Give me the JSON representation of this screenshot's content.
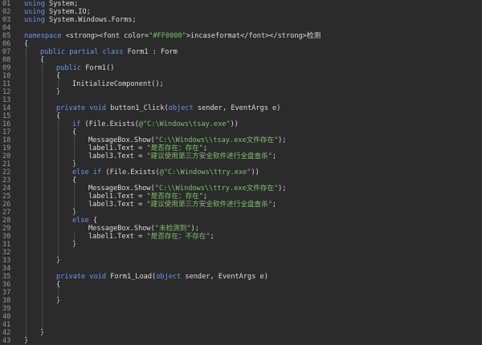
{
  "code": {
    "lines": [
      {
        "num": "01",
        "indent": 0,
        "segments": [
          {
            "t": "using",
            "c": "kw"
          },
          {
            "t": " System;",
            "c": "pl"
          }
        ]
      },
      {
        "num": "02",
        "indent": 0,
        "segments": [
          {
            "t": "using",
            "c": "kw"
          },
          {
            "t": " System.IO;",
            "c": "pl"
          }
        ]
      },
      {
        "num": "03",
        "indent": 0,
        "segments": [
          {
            "t": "using",
            "c": "kw"
          },
          {
            "t": " System.Windows.Forms;",
            "c": "pl"
          }
        ]
      },
      {
        "num": "04",
        "indent": 0,
        "segments": []
      },
      {
        "num": "05",
        "indent": 0,
        "segments": [
          {
            "t": "namespace",
            "c": "kw"
          },
          {
            "t": " <strong><font color=",
            "c": "pl"
          },
          {
            "t": "\"#FF0000\"",
            "c": "str"
          },
          {
            "t": ">incaseformat</font></strong>检测",
            "c": "pl"
          }
        ]
      },
      {
        "num": "06",
        "indent": 0,
        "segments": [
          {
            "t": "{",
            "c": "pl"
          }
        ]
      },
      {
        "num": "07",
        "indent": 1,
        "segments": [
          {
            "t": "public partial class",
            "c": "kw"
          },
          {
            "t": " Form1 : Form",
            "c": "pl"
          }
        ]
      },
      {
        "num": "08",
        "indent": 1,
        "segments": [
          {
            "t": "{",
            "c": "pl"
          }
        ]
      },
      {
        "num": "09",
        "indent": 2,
        "segments": [
          {
            "t": "public",
            "c": "kw"
          },
          {
            "t": " Form1()",
            "c": "pl"
          }
        ]
      },
      {
        "num": "10",
        "indent": 2,
        "segments": [
          {
            "t": "{",
            "c": "pl"
          }
        ]
      },
      {
        "num": "11",
        "indent": 3,
        "segments": [
          {
            "t": "InitializeComponent();",
            "c": "pl"
          }
        ]
      },
      {
        "num": "12",
        "indent": 2,
        "segments": [
          {
            "t": "}",
            "c": "pl"
          }
        ]
      },
      {
        "num": "13",
        "indent": 0,
        "segments": []
      },
      {
        "num": "14",
        "indent": 2,
        "segments": [
          {
            "t": "private void",
            "c": "kw"
          },
          {
            "t": " button1_Click(",
            "c": "pl"
          },
          {
            "t": "object",
            "c": "kw"
          },
          {
            "t": " sender, EventArgs e)",
            "c": "pl"
          }
        ]
      },
      {
        "num": "15",
        "indent": 2,
        "segments": [
          {
            "t": "{",
            "c": "pl"
          }
        ]
      },
      {
        "num": "16",
        "indent": 3,
        "segments": [
          {
            "t": "if",
            "c": "kw"
          },
          {
            "t": " (File.Exists(",
            "c": "pl"
          },
          {
            "t": "@\"C:\\Windows\\tsay.exe\"",
            "c": "str"
          },
          {
            "t": "))",
            "c": "pl"
          }
        ]
      },
      {
        "num": "17",
        "indent": 3,
        "segments": [
          {
            "t": "{",
            "c": "pl"
          }
        ]
      },
      {
        "num": "18",
        "indent": 4,
        "segments": [
          {
            "t": "MessageBox.Show(",
            "c": "pl"
          },
          {
            "t": "\"C:\\\\Windows\\\\tsay.exe文件存在\"",
            "c": "str"
          },
          {
            "t": ");",
            "c": "pl"
          }
        ]
      },
      {
        "num": "19",
        "indent": 4,
        "segments": [
          {
            "t": "label1.Text = ",
            "c": "pl"
          },
          {
            "t": "\"是否存在：存在\"",
            "c": "str"
          },
          {
            "t": ";",
            "c": "pl"
          }
        ]
      },
      {
        "num": "20",
        "indent": 4,
        "segments": [
          {
            "t": "label3.Text = ",
            "c": "pl"
          },
          {
            "t": "\"建议使用第三方安全软件进行全盘查杀\"",
            "c": "str"
          },
          {
            "t": ";",
            "c": "pl"
          }
        ]
      },
      {
        "num": "21",
        "indent": 3,
        "segments": [
          {
            "t": "}",
            "c": "pl"
          }
        ]
      },
      {
        "num": "22",
        "indent": 3,
        "segments": [
          {
            "t": "else if",
            "c": "kw"
          },
          {
            "t": " (File.Exists(",
            "c": "pl"
          },
          {
            "t": "@\"C:\\Windows\\ttry.exe\"",
            "c": "str"
          },
          {
            "t": "))",
            "c": "pl"
          }
        ]
      },
      {
        "num": "23",
        "indent": 3,
        "segments": [
          {
            "t": "{",
            "c": "pl"
          }
        ]
      },
      {
        "num": "24",
        "indent": 4,
        "segments": [
          {
            "t": "MessageBox.Show(",
            "c": "pl"
          },
          {
            "t": "\"C:\\\\Windows\\\\ttry.exe文件存在\"",
            "c": "str"
          },
          {
            "t": ");",
            "c": "pl"
          }
        ]
      },
      {
        "num": "25",
        "indent": 4,
        "segments": [
          {
            "t": "label1.Text = ",
            "c": "pl"
          },
          {
            "t": "\"是否存在：存在\"",
            "c": "str"
          },
          {
            "t": ";",
            "c": "pl"
          }
        ]
      },
      {
        "num": "26",
        "indent": 4,
        "segments": [
          {
            "t": "label3.Text = ",
            "c": "pl"
          },
          {
            "t": "\"建议使用第三方安全软件进行全盘查杀\"",
            "c": "str"
          },
          {
            "t": ";",
            "c": "pl"
          }
        ]
      },
      {
        "num": "27",
        "indent": 3,
        "segments": [
          {
            "t": "}",
            "c": "pl"
          }
        ]
      },
      {
        "num": "28",
        "indent": 3,
        "segments": [
          {
            "t": "else",
            "c": "kw"
          },
          {
            "t": " {",
            "c": "pl"
          }
        ]
      },
      {
        "num": "29",
        "indent": 4,
        "segments": [
          {
            "t": "MessageBox.Show(",
            "c": "pl"
          },
          {
            "t": "\"未检测到\"",
            "c": "str"
          },
          {
            "t": ");",
            "c": "pl"
          }
        ]
      },
      {
        "num": "30",
        "indent": 4,
        "segments": [
          {
            "t": "label1.Text = ",
            "c": "pl"
          },
          {
            "t": "\"是否存在：不存在\"",
            "c": "str"
          },
          {
            "t": ";",
            "c": "pl"
          }
        ]
      },
      {
        "num": "31",
        "indent": 3,
        "segments": [
          {
            "t": "}",
            "c": "pl"
          }
        ]
      },
      {
        "num": "32",
        "indent": 0,
        "segments": []
      },
      {
        "num": "33",
        "indent": 2,
        "segments": [
          {
            "t": "}",
            "c": "pl"
          }
        ]
      },
      {
        "num": "34",
        "indent": 0,
        "segments": []
      },
      {
        "num": "35",
        "indent": 2,
        "segments": [
          {
            "t": "private void",
            "c": "kw"
          },
          {
            "t": " Form1_Load(",
            "c": "pl"
          },
          {
            "t": "object",
            "c": "kw"
          },
          {
            "t": " sender, EventArgs e)",
            "c": "pl"
          }
        ]
      },
      {
        "num": "36",
        "indent": 2,
        "segments": [
          {
            "t": "{",
            "c": "pl"
          }
        ]
      },
      {
        "num": "37",
        "indent": 0,
        "segments": []
      },
      {
        "num": "38",
        "indent": 2,
        "segments": [
          {
            "t": "}",
            "c": "pl"
          }
        ]
      },
      {
        "num": "39",
        "indent": 0,
        "segments": []
      },
      {
        "num": "40",
        "indent": 0,
        "segments": []
      },
      {
        "num": "41",
        "indent": 0,
        "segments": []
      },
      {
        "num": "42",
        "indent": 1,
        "segments": [
          {
            "t": "}",
            "c": "pl"
          }
        ]
      },
      {
        "num": "43",
        "indent": 0,
        "segments": [
          {
            "t": "}",
            "c": "pl"
          }
        ]
      }
    ]
  },
  "colors": {
    "background": "#2b2b2b",
    "keyword": "#6c95eb",
    "string": "#7cc36e",
    "plain": "#dcdcdc",
    "line_number": "#9a9a9a"
  }
}
